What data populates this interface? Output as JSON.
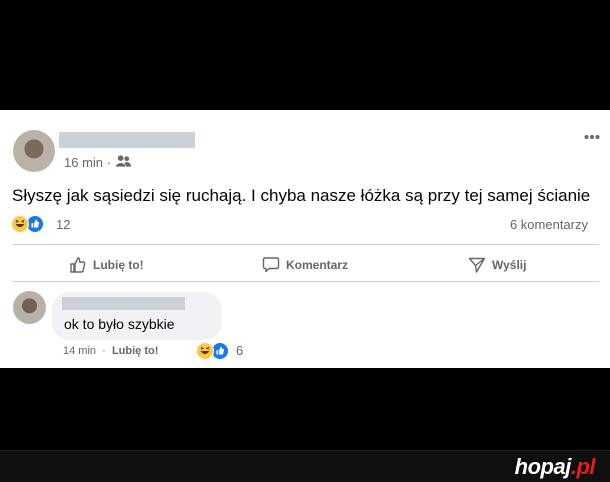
{
  "post": {
    "time": "16 min",
    "separator": "·",
    "text": "Słyszę jak sąsiedzi się ruchają. I chyba nasze łóżka są przy tej samej ścianie",
    "reactions_count": "12",
    "comments_count": "6 komentarzy"
  },
  "actions": {
    "like": "Lubię to!",
    "comment": "Komentarz",
    "share": "Wyślij"
  },
  "comment": {
    "text": "ok to było szybkie",
    "time": "14 min",
    "separator": "·",
    "like": "Lubię to!",
    "reactions_count": "6"
  },
  "watermark": {
    "brand": "hopaj",
    "dot": ".",
    "tld": "pl"
  },
  "colors": {
    "facebook_blue": "#1877f2",
    "secondary_text": "#65676b",
    "haha_yellow": "#f7c948",
    "brand_red": "#e21d1d"
  },
  "icons": [
    "people-icon",
    "more-options-icon",
    "haha-reaction-icon",
    "like-reaction-icon",
    "thumb-up-icon",
    "speech-bubble-icon",
    "send-icon"
  ]
}
